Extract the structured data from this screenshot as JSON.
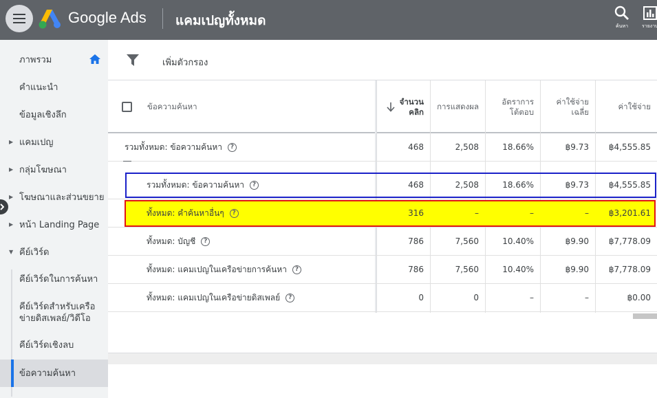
{
  "header": {
    "brand": "Google Ads",
    "page_title": "แคมเปญทั้งหมด",
    "tools": [
      {
        "icon": "search-icon",
        "label": "ค้นหา"
      },
      {
        "icon": "reports-icon",
        "label": "รายงาน"
      }
    ]
  },
  "sidebar": {
    "items": [
      {
        "label": "ภาพรวม",
        "icon": "home-icon"
      },
      {
        "label": "คำแนะนำ"
      },
      {
        "label": "ข้อมูลเชิงลึก"
      },
      {
        "label": "แคมเปญ",
        "expandable": true
      },
      {
        "label": "กลุ่มโฆษณา",
        "expandable": true
      },
      {
        "label": "โฆษณาและส่วนขยาย",
        "expandable": true
      },
      {
        "label": "หน้า Landing Page",
        "expandable": true
      },
      {
        "label": "คีย์เวิร์ด",
        "expanded": true
      },
      {
        "label": "คีย์เวิร์ดในการค้นหา"
      },
      {
        "label": "คีย์เวิร์ดสำหรับเครือข่ายดิสเพลย์/วิดีโอ",
        "line1": "คีย์เวิร์ดสำหรับเครือ",
        "line2": "ข่ายดิสเพลย์/วิดีโอ"
      },
      {
        "label": "คีย์เวิร์ดเชิงลบ"
      },
      {
        "label": "ข้อความค้นหา",
        "selected": true
      }
    ]
  },
  "filterbar": {
    "label": "เพิ่มตัวกรอง"
  },
  "table": {
    "headers": {
      "name": "ข้อความค้นหา",
      "clicks_line1": "จำนวน",
      "clicks_line2": "คลิก",
      "impressions": "การแสดงผล",
      "ctr_line1": "อัตราการ",
      "ctr_line2": "โต้ตอบ",
      "avg_cpc_line1": "ค่าใช้จ่าย",
      "avg_cpc_line2": "เฉลี่ย",
      "cost": "ค่าใช้จ่าย"
    },
    "rows": [
      {
        "name": "รวมทั้งหมด: ข้อความค้นหา",
        "clicks": "468",
        "impressions": "2,508",
        "ctr": "18.66%",
        "avg_cpc": "฿9.73",
        "cost": "฿4,555.85"
      },
      {
        "name": "รวมทั้งหมด: ข้อความค้นหา",
        "clicks": "468",
        "impressions": "2,508",
        "ctr": "18.66%",
        "avg_cpc": "฿9.73",
        "cost": "฿4,555.85"
      },
      {
        "name": "ทั้งหมด: คำค้นหาอื่นๆ",
        "clicks": "316",
        "impressions": "–",
        "ctr": "–",
        "avg_cpc": "–",
        "cost": "฿3,201.61"
      },
      {
        "name": "ทั้งหมด: บัญชี",
        "clicks": "786",
        "impressions": "7,560",
        "ctr": "10.40%",
        "avg_cpc": "฿9.90",
        "cost": "฿7,778.09"
      },
      {
        "name": "ทั้งหมด: แคมเปญในเครือข่ายการค้นหา",
        "clicks": "786",
        "impressions": "7,560",
        "ctr": "10.40%",
        "avg_cpc": "฿9.90",
        "cost": "฿7,778.09"
      },
      {
        "name": "ทั้งหมด: แคมเปญในเครือข่ายดิสเพลย์",
        "clicks": "0",
        "impressions": "0",
        "ctr": "–",
        "avg_cpc": "–",
        "cost": "฿0.00"
      }
    ]
  }
}
